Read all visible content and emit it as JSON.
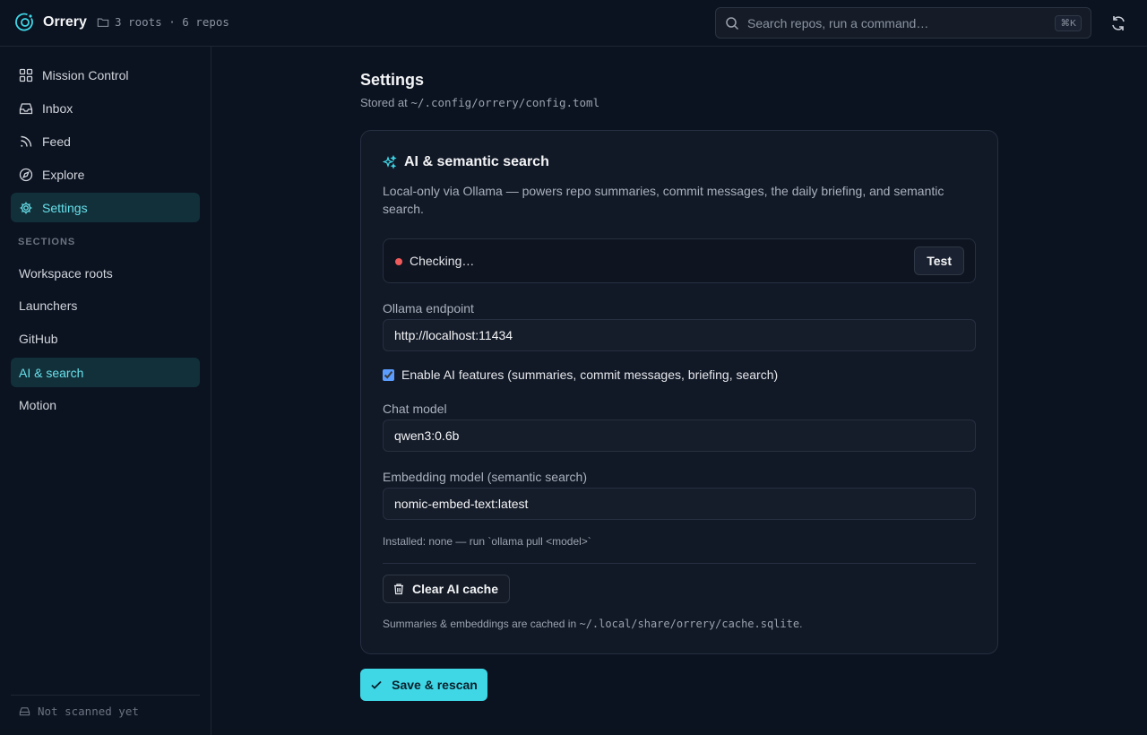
{
  "app": {
    "name": "Orrery",
    "roots_summary": "3 roots · 6 repos",
    "logo_icon": "orrery-logo-icon",
    "accent": "#3fd6e6"
  },
  "search": {
    "placeholder": "Search repos, run a command…",
    "shortcut": "⌘K"
  },
  "sidebar": {
    "nav": [
      {
        "label": "Mission Control",
        "icon": "grid-icon"
      },
      {
        "label": "Inbox",
        "icon": "inbox-icon"
      },
      {
        "label": "Feed",
        "icon": "rss-icon"
      },
      {
        "label": "Explore",
        "icon": "compass-icon"
      },
      {
        "label": "Settings",
        "icon": "gear-icon",
        "active": true
      }
    ],
    "sections_label": "SECTIONS",
    "sections": [
      {
        "label": "Workspace roots"
      },
      {
        "label": "Launchers"
      },
      {
        "label": "GitHub"
      },
      {
        "label": "AI & search",
        "active": true
      },
      {
        "label": "Motion"
      }
    ],
    "footer_status": "Not scanned yet"
  },
  "page": {
    "title": "Settings",
    "subtitle_prefix": "Stored at",
    "config_path": "~/.config/orrery/config.toml"
  },
  "ai_card": {
    "title": "AI & semantic search",
    "description": "Local-only via Ollama — powers repo summaries, commit messages, the daily briefing, and semantic search.",
    "status": {
      "text": "Checking…",
      "dot_color": "#ef5a5a"
    },
    "test_label": "Test",
    "endpoint_label": "Ollama endpoint",
    "endpoint_value": "http://localhost:11434",
    "enable_label": "Enable AI features (summaries, commit messages, briefing, search)",
    "enable_checked": true,
    "chat_model_label": "Chat model",
    "chat_model_value": "qwen3:0.6b",
    "embedding_label": "Embedding model (semantic search)",
    "embedding_value": "nomic-embed-text:latest",
    "installed_note": "Installed: none — run `ollama pull <model>`",
    "clear_cache_label": "Clear AI cache",
    "cache_note_prefix": "Summaries & embeddings are cached in",
    "cache_path": "~/.local/share/orrery/cache.sqlite",
    "cache_note_suffix": "."
  },
  "save_label": "Save & rescan"
}
